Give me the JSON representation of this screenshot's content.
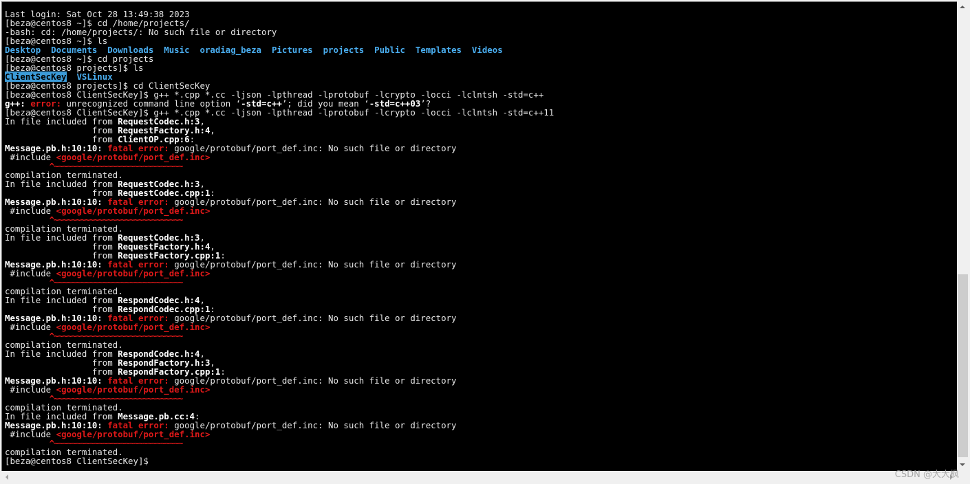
{
  "terminal": {
    "lines": [
      {
        "segments": [
          {
            "t": "Last login: Sat Oct 28 13:49:38 2023",
            "c": ""
          }
        ]
      },
      {
        "segments": [
          {
            "t": "[beza@centos8 ~]$ cd /home/projects/",
            "c": ""
          }
        ]
      },
      {
        "segments": [
          {
            "t": "-bash: cd: /home/projects/: No such file or directory",
            "c": ""
          }
        ]
      },
      {
        "segments": [
          {
            "t": "[beza@centos8 ~]$ ls",
            "c": ""
          }
        ]
      },
      {
        "segments": [
          {
            "t": "Desktop",
            "c": "dir"
          },
          {
            "t": "  ",
            "c": ""
          },
          {
            "t": "Documents",
            "c": "dir"
          },
          {
            "t": "  ",
            "c": ""
          },
          {
            "t": "Downloads",
            "c": "dir"
          },
          {
            "t": "  ",
            "c": ""
          },
          {
            "t": "Music",
            "c": "dir"
          },
          {
            "t": "  ",
            "c": ""
          },
          {
            "t": "oradiag_beza",
            "c": "dir"
          },
          {
            "t": "  ",
            "c": ""
          },
          {
            "t": "Pictures",
            "c": "dir"
          },
          {
            "t": "  ",
            "c": ""
          },
          {
            "t": "projects",
            "c": "dir"
          },
          {
            "t": "  ",
            "c": ""
          },
          {
            "t": "Public",
            "c": "dir"
          },
          {
            "t": "  ",
            "c": ""
          },
          {
            "t": "Templates",
            "c": "dir"
          },
          {
            "t": "  ",
            "c": ""
          },
          {
            "t": "Videos",
            "c": "dir"
          }
        ]
      },
      {
        "segments": [
          {
            "t": "[beza@centos8 ~]$ cd projects",
            "c": ""
          }
        ]
      },
      {
        "segments": [
          {
            "t": "[beza@centos8 projects]$ ls",
            "c": ""
          }
        ]
      },
      {
        "segments": [
          {
            "t": "ClientSecKey",
            "c": "hl"
          },
          {
            "t": "  ",
            "c": ""
          },
          {
            "t": "VSLinux",
            "c": "dir"
          }
        ]
      },
      {
        "segments": [
          {
            "t": "[beza@centos8 projects]$ cd ClientSecKey",
            "c": ""
          }
        ]
      },
      {
        "segments": [
          {
            "t": "[beza@centos8 ClientSecKey]$ g++ *.cpp *.cc -ljson -lpthread -lprotobuf -lcrypto -locci -lclntsh -std=c++",
            "c": ""
          }
        ]
      },
      {
        "segments": [
          {
            "t": "g++: ",
            "c": "b"
          },
          {
            "t": "error: ",
            "c": "err"
          },
          {
            "t": "unrecognized command line option ‘",
            "c": ""
          },
          {
            "t": "-std=c++",
            "c": "b"
          },
          {
            "t": "’; did you mean ‘",
            "c": ""
          },
          {
            "t": "-std=c++03",
            "c": "b"
          },
          {
            "t": "’?",
            "c": ""
          }
        ]
      },
      {
        "segments": [
          {
            "t": "[beza@centos8 ClientSecKey]$ g++ *.cpp *.cc -ljson -lpthread -lprotobuf -lcrypto -locci -lclntsh -std=c++11",
            "c": ""
          }
        ]
      },
      {
        "segments": [
          {
            "t": "In file included from ",
            "c": ""
          },
          {
            "t": "RequestCodec.h:3",
            "c": "b"
          },
          {
            "t": ",",
            "c": ""
          }
        ]
      },
      {
        "segments": [
          {
            "t": "                 from ",
            "c": ""
          },
          {
            "t": "RequestFactory.h:4",
            "c": "b"
          },
          {
            "t": ",",
            "c": ""
          }
        ]
      },
      {
        "segments": [
          {
            "t": "                 from ",
            "c": ""
          },
          {
            "t": "ClientOP.cpp:6",
            "c": "b"
          },
          {
            "t": ":",
            "c": ""
          }
        ]
      },
      {
        "segments": [
          {
            "t": "Message.pb.h:10:10: ",
            "c": "b"
          },
          {
            "t": "fatal error: ",
            "c": "err"
          },
          {
            "t": "google/protobuf/port_def.inc: No such file or directory",
            "c": ""
          }
        ]
      },
      {
        "segments": [
          {
            "t": " #include ",
            "c": ""
          },
          {
            "t": "<google/protobuf/port_def.inc>",
            "c": "err"
          }
        ]
      },
      {
        "segments": [
          {
            "t": "          ^~~~~~~~~~~~~~~~~~~~~~~~~~~~~~",
            "c": "caret"
          }
        ]
      },
      {
        "segments": [
          {
            "t": "compilation terminated.",
            "c": ""
          }
        ]
      },
      {
        "segments": [
          {
            "t": "In file included from ",
            "c": ""
          },
          {
            "t": "RequestCodec.h:3",
            "c": "b"
          },
          {
            "t": ",",
            "c": ""
          }
        ]
      },
      {
        "segments": [
          {
            "t": "                 from ",
            "c": ""
          },
          {
            "t": "RequestCodec.cpp:1",
            "c": "b"
          },
          {
            "t": ":",
            "c": ""
          }
        ]
      },
      {
        "segments": [
          {
            "t": "Message.pb.h:10:10: ",
            "c": "b"
          },
          {
            "t": "fatal error: ",
            "c": "err"
          },
          {
            "t": "google/protobuf/port_def.inc: No such file or directory",
            "c": ""
          }
        ]
      },
      {
        "segments": [
          {
            "t": " #include ",
            "c": ""
          },
          {
            "t": "<google/protobuf/port_def.inc>",
            "c": "err"
          }
        ]
      },
      {
        "segments": [
          {
            "t": "          ^~~~~~~~~~~~~~~~~~~~~~~~~~~~~~",
            "c": "caret"
          }
        ]
      },
      {
        "segments": [
          {
            "t": "compilation terminated.",
            "c": ""
          }
        ]
      },
      {
        "segments": [
          {
            "t": "In file included from ",
            "c": ""
          },
          {
            "t": "RequestCodec.h:3",
            "c": "b"
          },
          {
            "t": ",",
            "c": ""
          }
        ]
      },
      {
        "segments": [
          {
            "t": "                 from ",
            "c": ""
          },
          {
            "t": "RequestFactory.h:4",
            "c": "b"
          },
          {
            "t": ",",
            "c": ""
          }
        ]
      },
      {
        "segments": [
          {
            "t": "                 from ",
            "c": ""
          },
          {
            "t": "RequestFactory.cpp:1",
            "c": "b"
          },
          {
            "t": ":",
            "c": ""
          }
        ]
      },
      {
        "segments": [
          {
            "t": "Message.pb.h:10:10: ",
            "c": "b"
          },
          {
            "t": "fatal error: ",
            "c": "err"
          },
          {
            "t": "google/protobuf/port_def.inc: No such file or directory",
            "c": ""
          }
        ]
      },
      {
        "segments": [
          {
            "t": " #include ",
            "c": ""
          },
          {
            "t": "<google/protobuf/port_def.inc>",
            "c": "err"
          }
        ]
      },
      {
        "segments": [
          {
            "t": "          ^~~~~~~~~~~~~~~~~~~~~~~~~~~~~~",
            "c": "caret"
          }
        ]
      },
      {
        "segments": [
          {
            "t": "compilation terminated.",
            "c": ""
          }
        ]
      },
      {
        "segments": [
          {
            "t": "In file included from ",
            "c": ""
          },
          {
            "t": "RespondCodec.h:4",
            "c": "b"
          },
          {
            "t": ",",
            "c": ""
          }
        ]
      },
      {
        "segments": [
          {
            "t": "                 from ",
            "c": ""
          },
          {
            "t": "RespondCodec.cpp:1",
            "c": "b"
          },
          {
            "t": ":",
            "c": ""
          }
        ]
      },
      {
        "segments": [
          {
            "t": "Message.pb.h:10:10: ",
            "c": "b"
          },
          {
            "t": "fatal error: ",
            "c": "err"
          },
          {
            "t": "google/protobuf/port_def.inc: No such file or directory",
            "c": ""
          }
        ]
      },
      {
        "segments": [
          {
            "t": " #include ",
            "c": ""
          },
          {
            "t": "<google/protobuf/port_def.inc>",
            "c": "err"
          }
        ]
      },
      {
        "segments": [
          {
            "t": "          ^~~~~~~~~~~~~~~~~~~~~~~~~~~~~~",
            "c": "caret"
          }
        ]
      },
      {
        "segments": [
          {
            "t": "compilation terminated.",
            "c": ""
          }
        ]
      },
      {
        "segments": [
          {
            "t": "In file included from ",
            "c": ""
          },
          {
            "t": "RespondCodec.h:4",
            "c": "b"
          },
          {
            "t": ",",
            "c": ""
          }
        ]
      },
      {
        "segments": [
          {
            "t": "                 from ",
            "c": ""
          },
          {
            "t": "RespondFactory.h:3",
            "c": "b"
          },
          {
            "t": ",",
            "c": ""
          }
        ]
      },
      {
        "segments": [
          {
            "t": "                 from ",
            "c": ""
          },
          {
            "t": "RespondFactory.cpp:1",
            "c": "b"
          },
          {
            "t": ":",
            "c": ""
          }
        ]
      },
      {
        "segments": [
          {
            "t": "Message.pb.h:10:10: ",
            "c": "b"
          },
          {
            "t": "fatal error: ",
            "c": "err"
          },
          {
            "t": "google/protobuf/port_def.inc: No such file or directory",
            "c": ""
          }
        ]
      },
      {
        "segments": [
          {
            "t": " #include ",
            "c": ""
          },
          {
            "t": "<google/protobuf/port_def.inc>",
            "c": "err"
          }
        ]
      },
      {
        "segments": [
          {
            "t": "          ^~~~~~~~~~~~~~~~~~~~~~~~~~~~~~",
            "c": "caret"
          }
        ]
      },
      {
        "segments": [
          {
            "t": "compilation terminated.",
            "c": ""
          }
        ]
      },
      {
        "segments": [
          {
            "t": "In file included from ",
            "c": ""
          },
          {
            "t": "Message.pb.cc:4",
            "c": "b"
          },
          {
            "t": ":",
            "c": ""
          }
        ]
      },
      {
        "segments": [
          {
            "t": "Message.pb.h:10:10: ",
            "c": "b"
          },
          {
            "t": "fatal error: ",
            "c": "err"
          },
          {
            "t": "google/protobuf/port_def.inc: No such file or directory",
            "c": ""
          }
        ]
      },
      {
        "segments": [
          {
            "t": " #include ",
            "c": ""
          },
          {
            "t": "<google/protobuf/port_def.inc>",
            "c": "err"
          }
        ]
      },
      {
        "segments": [
          {
            "t": "          ^~~~~~~~~~~~~~~~~~~~~~~~~~~~~~",
            "c": "caret"
          }
        ]
      },
      {
        "segments": [
          {
            "t": "compilation terminated.",
            "c": ""
          }
        ]
      },
      {
        "segments": [
          {
            "t": "[beza@centos8 ClientSecKey]$ ",
            "c": ""
          }
        ]
      }
    ]
  },
  "scrollbars": {
    "vertical_icons": {
      "up": "arrow-up-icon",
      "down": "arrow-down-icon"
    },
    "horizontal_icons": {
      "left": "arrow-left-icon",
      "right": "arrow-right-icon"
    }
  },
  "watermark": {
    "text": "CSDN @大大枫"
  },
  "colors": {
    "background": "#000000",
    "text": "#e6e6e6",
    "error": "#e01919",
    "directory": "#4aaef0",
    "highlight": "#3c9bd8"
  }
}
